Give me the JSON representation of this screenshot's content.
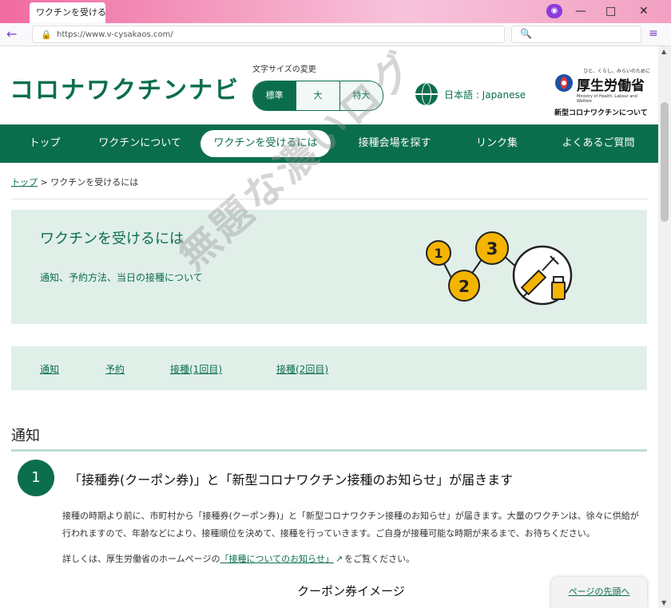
{
  "browser": {
    "tab_title": "ワクチンを受けるに",
    "url": "https://www.v-cysakaos.com/"
  },
  "site": {
    "logo": "コロナワクチンナビ",
    "font_size_label": "文字サイズの変更",
    "font_sizes": [
      "標準",
      "大",
      "特大"
    ],
    "language": "日本語 : Japanese",
    "mhlw_tagline": "ひと、くらし、みらいのために",
    "mhlw_name": "厚生労働省",
    "mhlw_en": "Ministry of Health, Labour and Welfare",
    "mhlw_sub": "新型コロナワクチンについて"
  },
  "nav": {
    "items": [
      "トップ",
      "ワクチンについて",
      "ワクチンを受けるには",
      "接種会場を探す",
      "リンク集",
      "よくあるご質問"
    ]
  },
  "breadcrumb": {
    "home": "トップ",
    "current": "ワクチンを受けるには"
  },
  "hero": {
    "title": "ワクチンを受けるには",
    "subtitle": "通知、予約方法、当日の接種について",
    "steps": [
      "1",
      "2",
      "3"
    ]
  },
  "anchors": [
    "通知",
    "予約",
    "接種(1回目)",
    "接種(2回目)"
  ],
  "section": {
    "title": "通知",
    "step_number": "1",
    "step_title": "「接種券(クーポン券)」と「新型コロナワクチン接種のお知らせ」が届きます",
    "paragraph": "接種の時期より前に、市町村から「接種券(クーポン券)」と「新型コロナワクチン接種のお知らせ」が届きます。大量のワクチンは、徐々に供給が行われますので、年齢などにより、接種順位を決めて、接種を行っていきます。ご自身が接種可能な時期が来るまで、お待ちください。",
    "detail_prefix": "詳しくは、厚生労働省のホームページの",
    "detail_link": "「接種についてのお知らせ」",
    "detail_suffix": "をご覧ください。",
    "coupon_heading": "クーポン券イメージ"
  },
  "to_top": "ページの先頭へ",
  "watermark": "無題な濃いログ",
  "colors": {
    "brand_green": "#0a6e4d",
    "light_green_bg": "#e1efe9",
    "step_yellow": "#f5b400"
  }
}
